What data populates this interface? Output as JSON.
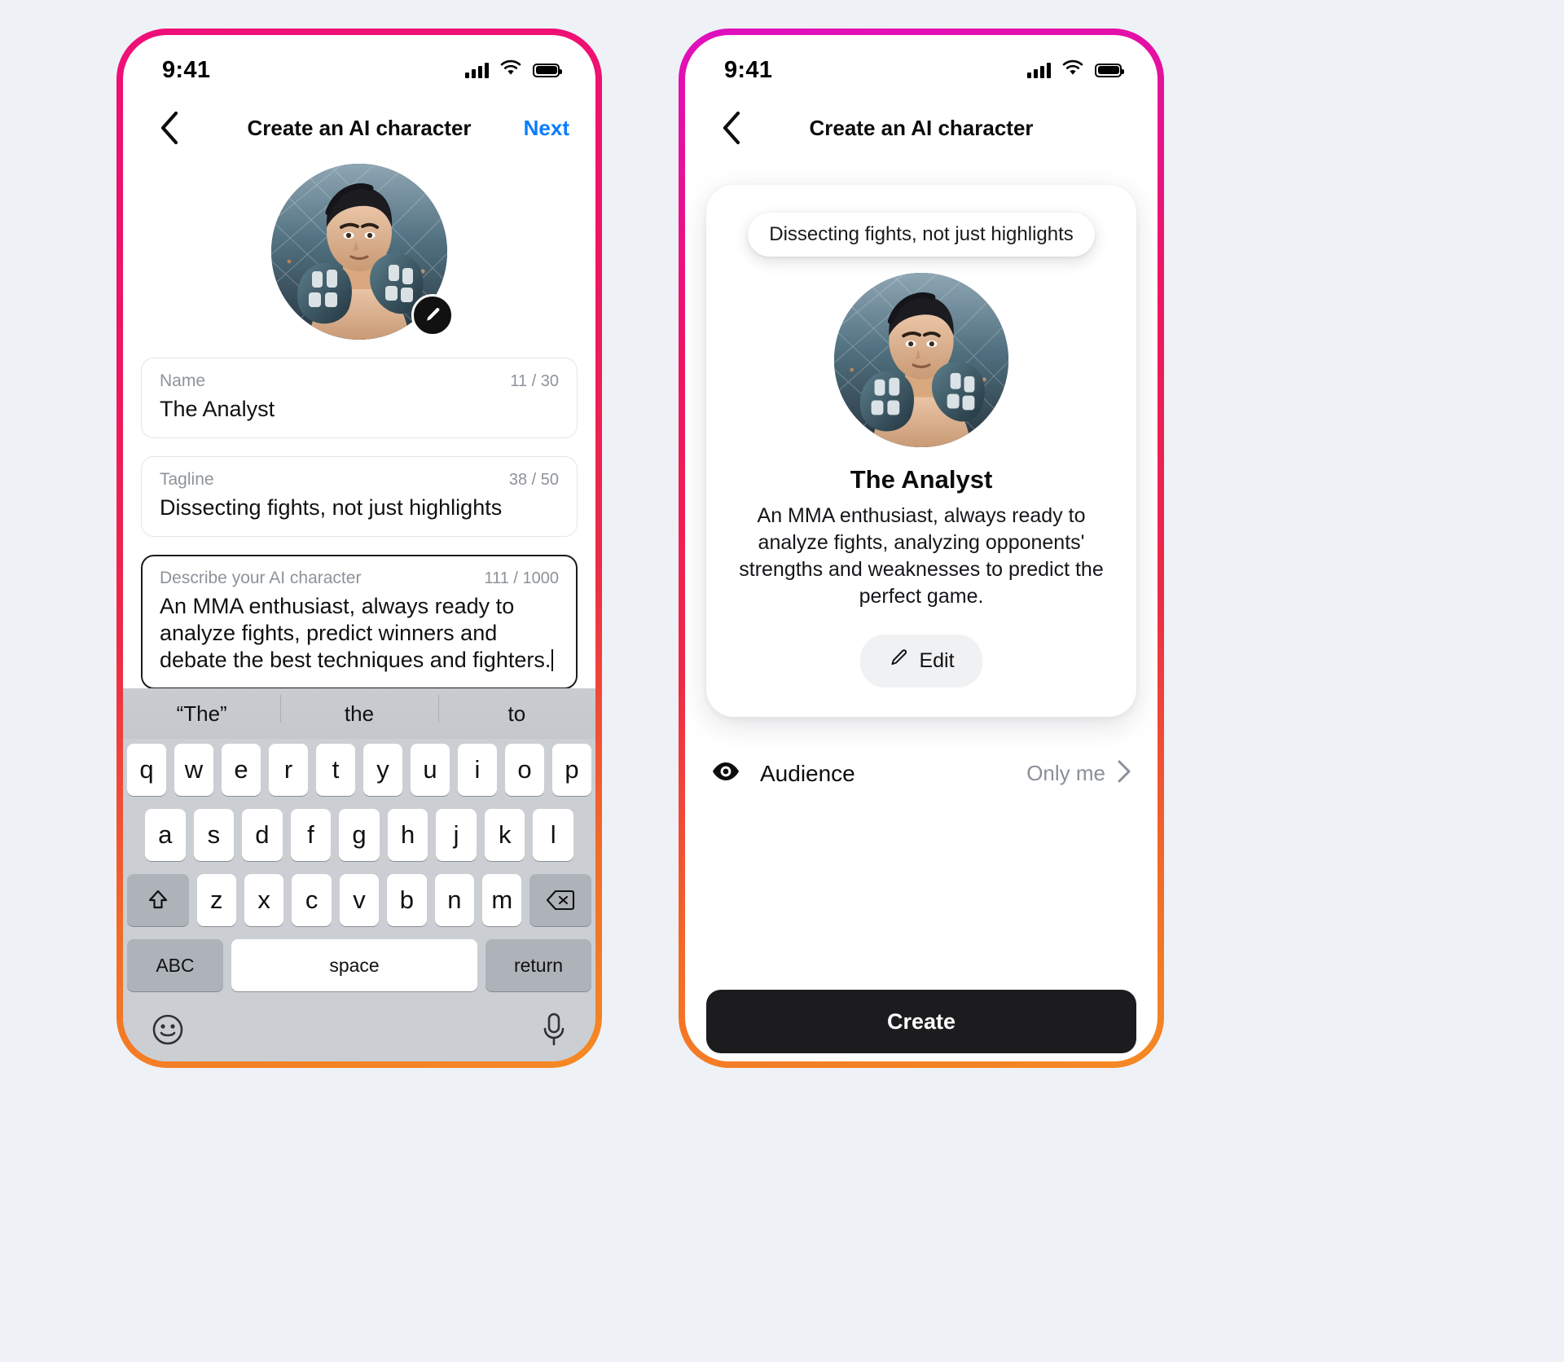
{
  "status_bar": {
    "time": "9:41",
    "signal_icon": "cellular-signal-icon",
    "wifi_icon": "wifi-icon",
    "battery_icon": "battery-full-icon"
  },
  "left_screen": {
    "nav": {
      "back_icon": "chevron-left-icon",
      "title": "Create an AI character",
      "next_label": "Next"
    },
    "avatar": {
      "alt": "mma-fighter-avatar",
      "edit_icon": "pencil-edit-icon"
    },
    "fields": [
      {
        "label": "Name",
        "counter": "11 / 30",
        "value": "The Analyst",
        "focused": false
      },
      {
        "label": "Tagline",
        "counter": "38 / 50",
        "value": "Dissecting fights, not just highlights",
        "focused": false
      },
      {
        "label": "Describe your AI character",
        "counter": "111 / 1000",
        "value": "An MMA enthusiast, always ready to analyze fights, predict winners and debate the best techniques and fighters.",
        "focused": true
      }
    ],
    "keyboard": {
      "suggestions": [
        "“The”",
        "the",
        "to"
      ],
      "row1": [
        "q",
        "w",
        "e",
        "r",
        "t",
        "y",
        "u",
        "i",
        "o",
        "p"
      ],
      "row2": [
        "a",
        "s",
        "d",
        "f",
        "g",
        "h",
        "j",
        "k",
        "l"
      ],
      "row3": [
        "z",
        "x",
        "c",
        "v",
        "b",
        "n",
        "m"
      ],
      "shift_icon": "shift-arrow-icon",
      "delete_icon": "backspace-delete-icon",
      "abc_label": "ABC",
      "space_label": "space",
      "return_label": "return",
      "emoji_icon": "emoji-smiley-icon",
      "mic_icon": "microphone-icon"
    }
  },
  "right_screen": {
    "nav": {
      "back_icon": "chevron-left-icon",
      "title": "Create an AI character"
    },
    "preview": {
      "tagline_bubble": "Dissecting fights, not just highlights",
      "avatar_alt": "mma-fighter-avatar",
      "name": "The Analyst",
      "description": "An MMA enthusiast, always ready to analyze fights, analyzing opponents' strengths and weaknesses to predict the perfect game.",
      "edit_label": "Edit",
      "edit_icon": "pencil-edit-icon"
    },
    "audience": {
      "icon": "audience-eye-icon",
      "label": "Audience",
      "value": "Only me",
      "chevron_icon": "chevron-right-icon"
    },
    "create_label": "Create"
  },
  "colors": {
    "background": "#eef2f7",
    "frame_gradient_start": "#e90f86",
    "frame_gradient_end": "#f58a24",
    "accent_blue": "#0a7cff",
    "primary_dark": "#1c1c1e",
    "muted_text": "#8d9399"
  }
}
